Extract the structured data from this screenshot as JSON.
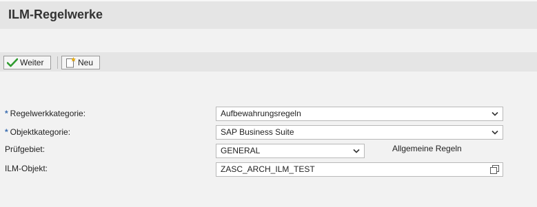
{
  "header": {
    "title": "ILM-Regelwerke"
  },
  "toolbar": {
    "continue_label": "Weiter",
    "new_label": "Neu"
  },
  "form": {
    "rule_category": {
      "label": "Regelwerkkategorie:",
      "required_mark": "*",
      "value": "Aufbewahrungsregeln"
    },
    "object_category": {
      "label": "Objektkategorie:",
      "required_mark": "*",
      "value": "SAP Business Suite"
    },
    "audit_area": {
      "label": "Prüfgebiet:",
      "value": "GENERAL",
      "description": "Allgemeine Regeln"
    },
    "ilm_object": {
      "label": "ILM-Objekt:",
      "value": "ZASC_ARCH_ILM_TEST"
    }
  },
  "colors": {
    "accent": "#3a6db0",
    "check": "#2e9b2e"
  }
}
